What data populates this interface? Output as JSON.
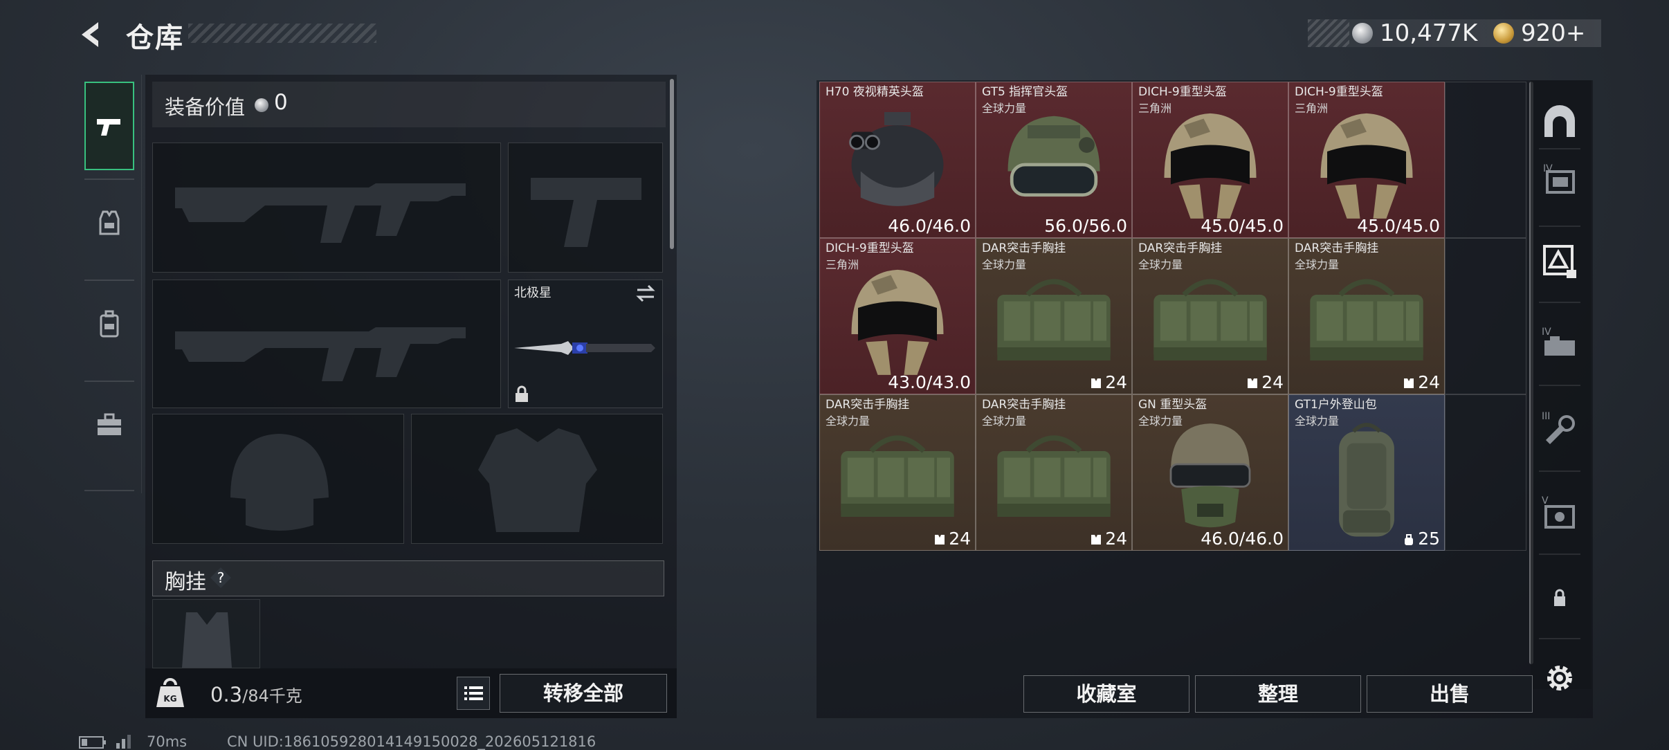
{
  "header": {
    "title": "仓库"
  },
  "currency": {
    "silver": "10,477K",
    "gold": "920+"
  },
  "left": {
    "equip_value_label": "装备价值",
    "equip_value": "0",
    "melee_name": "北极星",
    "chest_label": "胸挂",
    "help": "?",
    "weight": "0.3",
    "weight_cap": "/84千克",
    "weight_icon_text": "KG",
    "transfer_all": "转移全部"
  },
  "stash_items": [
    {
      "name": "H70 夜视精英头盔",
      "sub": "",
      "value": "46.0/46.0",
      "bg": "red",
      "kind": "nv-helmet"
    },
    {
      "name": "GT5 指挥官头盔",
      "sub": "全球力量",
      "value": "56.0/56.0",
      "bg": "red",
      "kind": "gt5-helmet"
    },
    {
      "name": "DICH-9重型头盔",
      "sub": "三角洲",
      "value": "45.0/45.0",
      "bg": "red",
      "kind": "dich-helmet"
    },
    {
      "name": "DICH-9重型头盔",
      "sub": "三角洲",
      "value": "45.0/45.0",
      "bg": "red",
      "kind": "dich-helmet"
    },
    {
      "name": "DICH-9重型头盔",
      "sub": "三角洲",
      "value": "43.0/43.0",
      "bg": "red",
      "kind": "dich-helmet"
    },
    {
      "name": "DAR突击手胸挂",
      "sub": "全球力量",
      "value": "24",
      "bg": "brown",
      "kind": "chest-rig"
    },
    {
      "name": "DAR突击手胸挂",
      "sub": "全球力量",
      "value": "24",
      "bg": "brown",
      "kind": "chest-rig"
    },
    {
      "name": "DAR突击手胸挂",
      "sub": "全球力量",
      "value": "24",
      "bg": "brown",
      "kind": "chest-rig"
    },
    {
      "name": "DAR突击手胸挂",
      "sub": "全球力量",
      "value": "24",
      "bg": "brown",
      "kind": "chest-rig"
    },
    {
      "name": "DAR突击手胸挂",
      "sub": "全球力量",
      "value": "24",
      "bg": "brown",
      "kind": "chest-rig"
    },
    {
      "name": "GN 重型头盔",
      "sub": "全球力量",
      "value": "46.0/46.0",
      "bg": "brown",
      "kind": "gn-helmet"
    },
    {
      "name": "GT1户外登山包",
      "sub": "全球力量",
      "value": "25",
      "bg": "blue",
      "kind": "backpack"
    }
  ],
  "right_rail": {
    "tier4": "IV",
    "tier3": "III",
    "tier5": "V"
  },
  "actions": {
    "collection": "收藏室",
    "organize": "整理",
    "sell": "出售"
  },
  "status": {
    "ping": "70ms",
    "uid": "CN UID:18610592801414915002​8_202605121816"
  },
  "colors": {
    "accent_green": "#38c17f",
    "item_red": "#5a2a2f",
    "item_brown": "#4a3b2e",
    "item_blue": "#333a4d"
  }
}
